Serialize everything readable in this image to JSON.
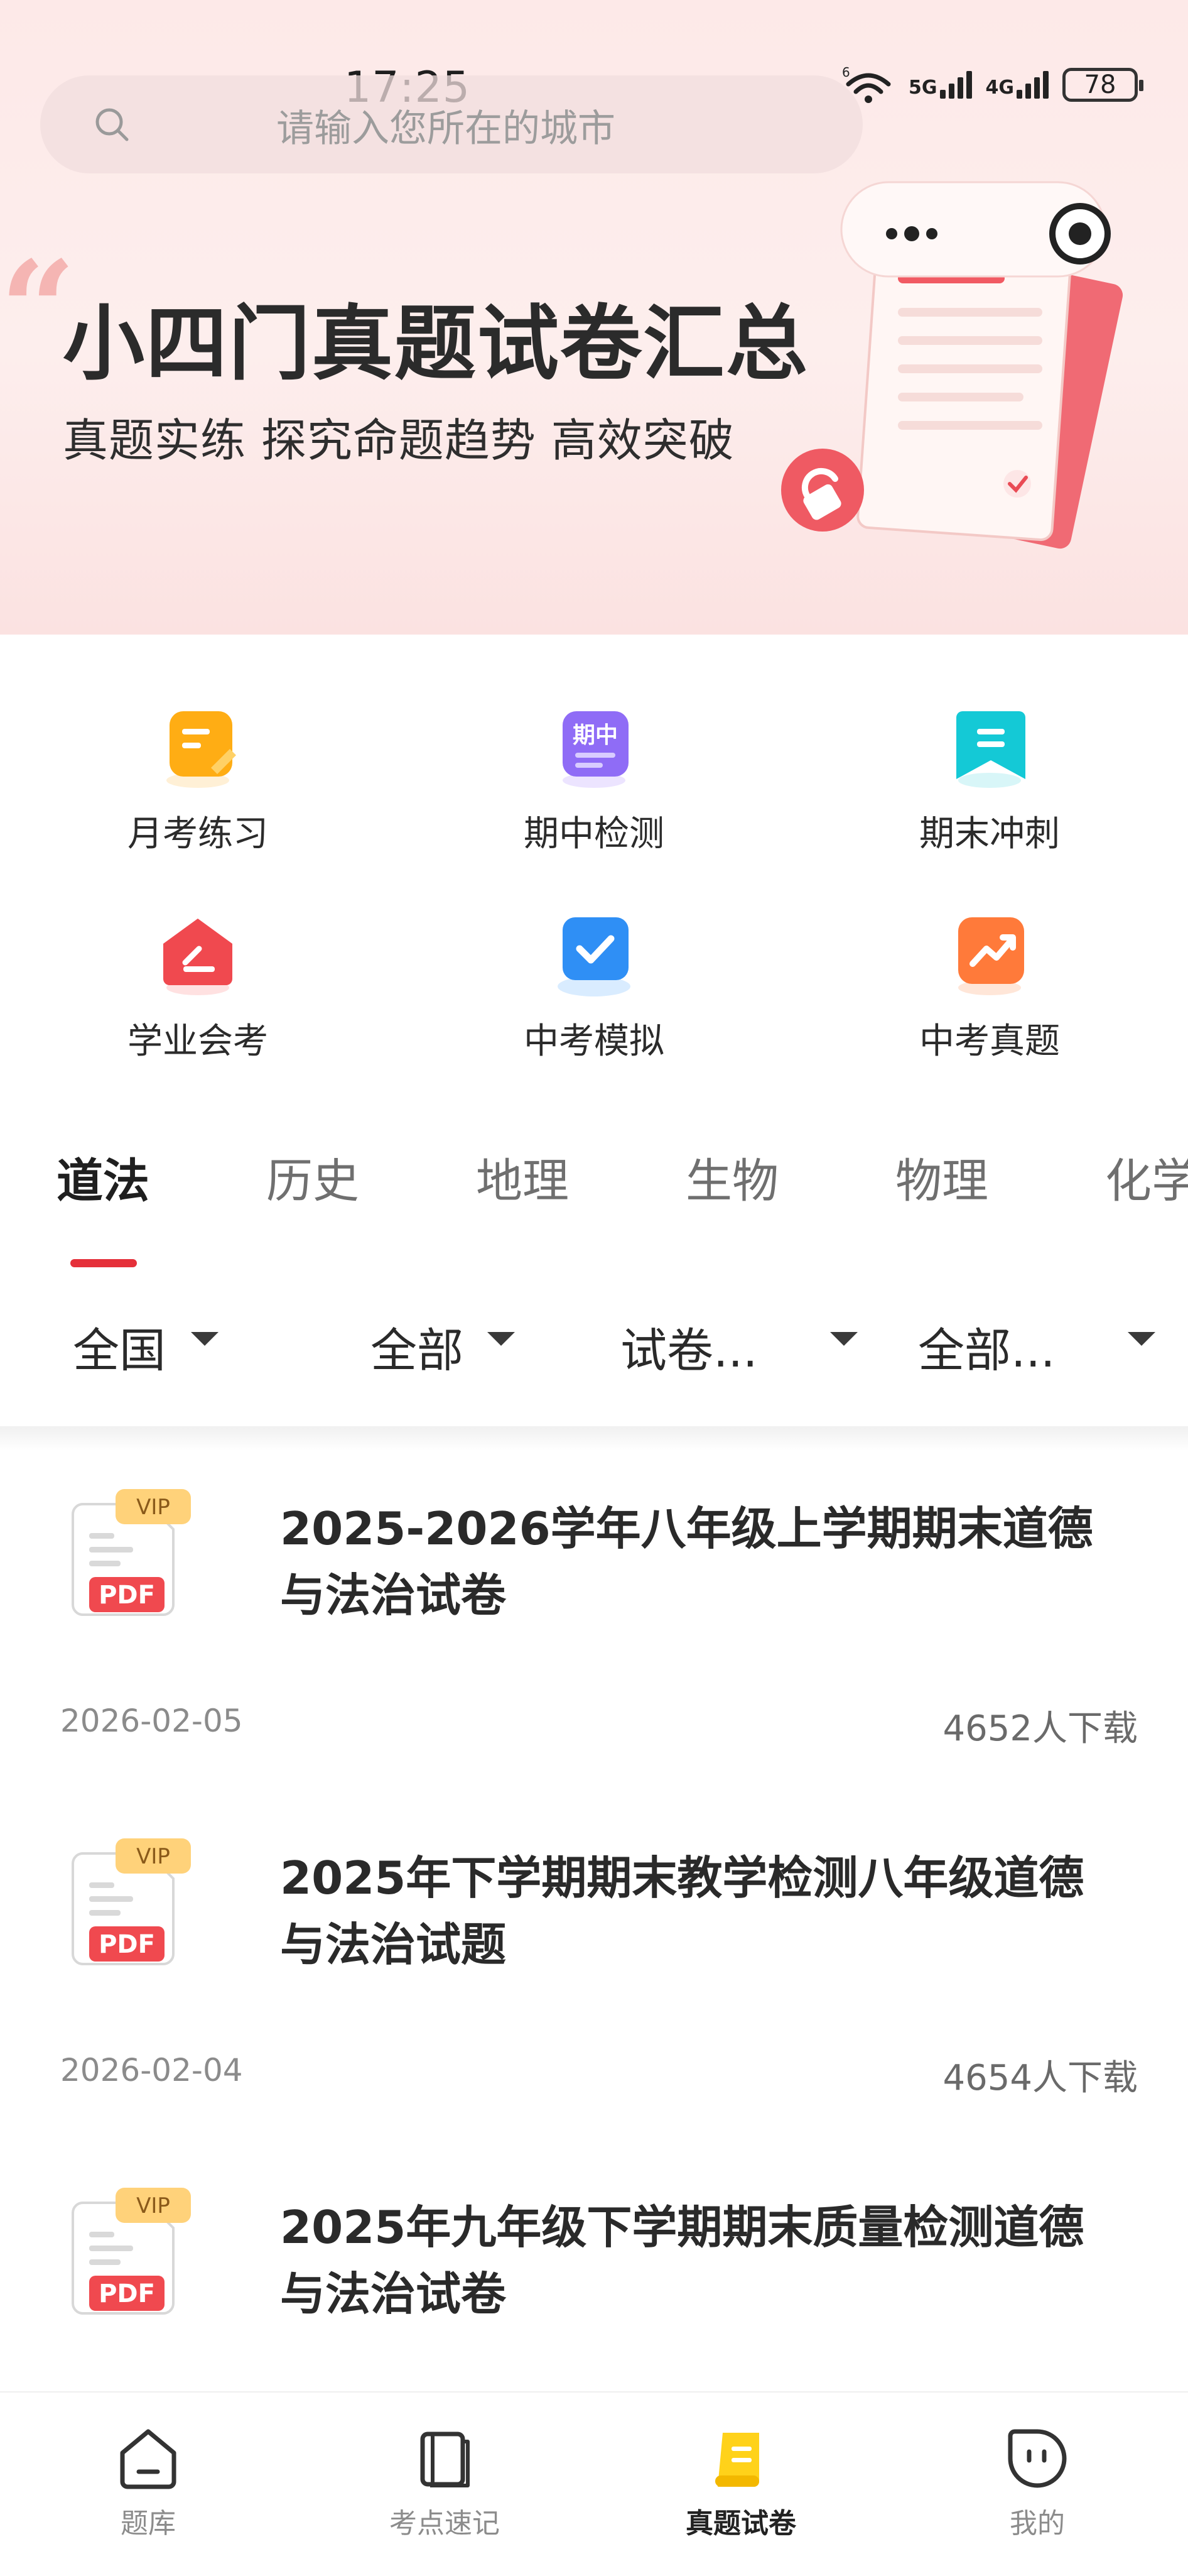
{
  "status_bar": {
    "time": "17:25",
    "network_label_1": "5G",
    "network_label_2": "4G",
    "wifi_sup": "6",
    "battery": "78"
  },
  "search": {
    "placeholder": "请输入您所在的城市"
  },
  "banner": {
    "title": "小四门真题试卷汇总",
    "subtitle": "真题实练 探究命题趋势 高效突破",
    "accent_color": "#e94b55"
  },
  "features": [
    {
      "label": "月考练习",
      "icon": "note-icon",
      "color": "#ffad14"
    },
    {
      "label": "期中检测",
      "icon": "midterm-icon",
      "color": "#8f6cf6",
      "badge": "期中"
    },
    {
      "label": "期末冲刺",
      "icon": "bookmark-icon",
      "color": "#14c9d6"
    },
    {
      "label": "学业会考",
      "icon": "home-exam-icon",
      "color": "#f0494f"
    },
    {
      "label": "中考模拟",
      "icon": "check-icon",
      "color": "#2f8ff5"
    },
    {
      "label": "中考真题",
      "icon": "trend-icon",
      "color": "#ff7a3a"
    }
  ],
  "subject_tabs": [
    {
      "label": "道法",
      "active": true
    },
    {
      "label": "历史",
      "active": false
    },
    {
      "label": "地理",
      "active": false
    },
    {
      "label": "生物",
      "active": false
    },
    {
      "label": "物理",
      "active": false
    },
    {
      "label": "化学",
      "active": false
    }
  ],
  "filters": [
    {
      "label": "全国"
    },
    {
      "label": "全部"
    },
    {
      "label": "试卷..."
    },
    {
      "label": "全部..."
    }
  ],
  "documents": [
    {
      "badge": "VIP",
      "file_type": "PDF",
      "title_line1": "2025-2026学年八年级上学期期末道德",
      "title_line2": "与法治试卷",
      "date": "2026-02-05",
      "downloads": "4652人下载"
    },
    {
      "badge": "VIP",
      "file_type": "PDF",
      "title_line1": "2025年下学期期末教学检测八年级道德",
      "title_line2": "与法治试题",
      "date": "2026-02-04",
      "downloads": "4654人下载"
    },
    {
      "badge": "VIP",
      "file_type": "PDF",
      "title_line1": "2025年九年级下学期期末质量检测道德",
      "title_line2": "与法治试卷",
      "date": "",
      "downloads": ""
    }
  ],
  "bottom_nav": [
    {
      "label": "题库",
      "icon": "home-icon",
      "active": false
    },
    {
      "label": "考点速记",
      "icon": "book-icon",
      "active": false
    },
    {
      "label": "真题试卷",
      "icon": "scroll-icon",
      "active": true
    },
    {
      "label": "我的",
      "icon": "profile-face-icon",
      "active": false
    }
  ]
}
